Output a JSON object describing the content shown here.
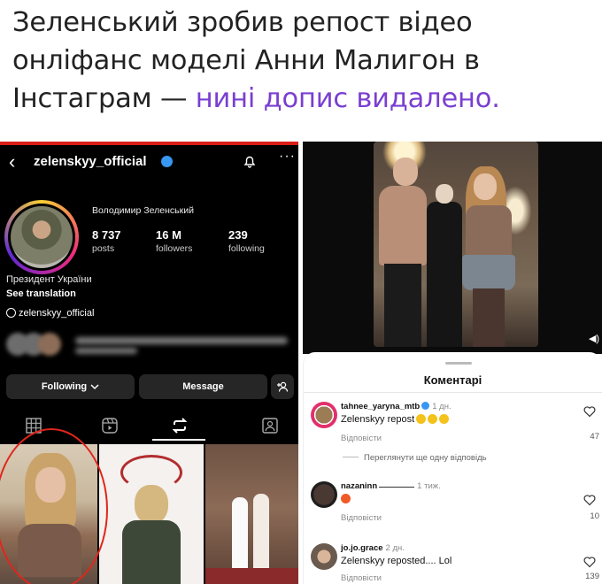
{
  "headline": {
    "text_before": "Зеленський зробив репост відео онліфанс моделі Анни Малигон в Інстаграм — ",
    "text_highlight": "нині допис видалено.",
    "highlight_color": "#7a3fd0"
  },
  "profile": {
    "back_icon": "chevron-left-icon",
    "handle": "zelenskyy_official",
    "display_name": "Володимир Зеленський",
    "stats": [
      {
        "value": "8 737",
        "label": "posts"
      },
      {
        "value": "16 M",
        "label": "followers"
      },
      {
        "value": "239",
        "label": "following"
      }
    ],
    "bio_title": "Президент України",
    "see_translation": "See translation",
    "threads_handle": "zelenskyy_official",
    "following_button": "Following",
    "message_button": "Message"
  },
  "comments": {
    "title": "Коментарі",
    "more_replies": "Переглянути ще одну відповідь",
    "items": [
      {
        "user": "tahnee_yaryna_mtb",
        "time": "1 дн.",
        "text": "Zelenskyy repost",
        "reply": "Відповісти",
        "likes": "47"
      },
      {
        "user": "nazaninn",
        "time": "1 тиж.",
        "text": "",
        "reply": "Відповісти",
        "likes": "10"
      },
      {
        "user": "jo.jo.grace",
        "time": "2 дн.",
        "text": "Zelenskyy reposted.... Lol",
        "reply": "Відповісти",
        "likes": "139"
      }
    ]
  }
}
